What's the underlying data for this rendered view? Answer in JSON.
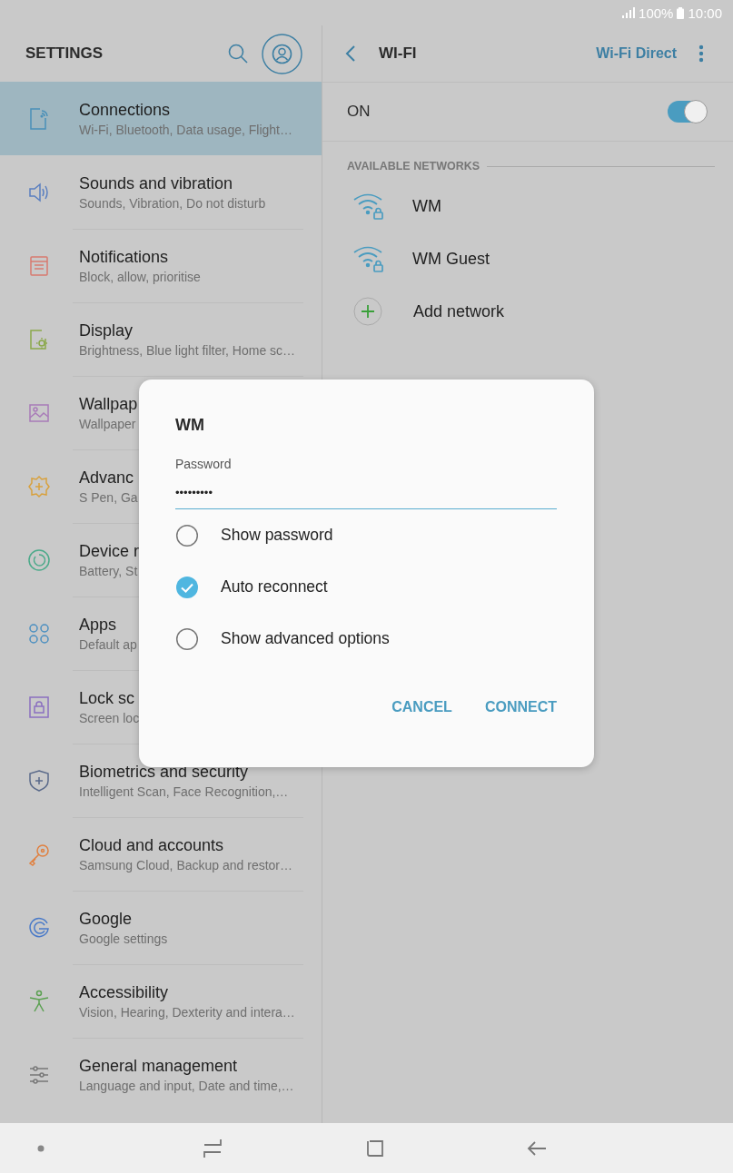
{
  "status_bar": {
    "battery": "100%",
    "time": "10:00"
  },
  "settings": {
    "title": "SETTINGS",
    "items": [
      {
        "title": "Connections",
        "subtitle": "Wi-Fi, Bluetooth, Data usage, Flight…",
        "selected": true
      },
      {
        "title": "Sounds and vibration",
        "subtitle": "Sounds, Vibration, Do not disturb",
        "selected": false
      },
      {
        "title": "Notifications",
        "subtitle": "Block, allow, prioritise",
        "selected": false
      },
      {
        "title": "Display",
        "subtitle": "Brightness, Blue light filter, Home sc…",
        "selected": false
      },
      {
        "title": "Wallpap",
        "subtitle": "Wallpaper",
        "selected": false
      },
      {
        "title": "Advanc",
        "subtitle": "S Pen, Ga",
        "selected": false
      },
      {
        "title": "Device r",
        "subtitle": "Battery, St",
        "selected": false
      },
      {
        "title": "Apps",
        "subtitle": "Default ap",
        "selected": false
      },
      {
        "title": "Lock sc",
        "subtitle": "Screen loc",
        "selected": false
      },
      {
        "title": "Biometrics and security",
        "subtitle": "Intelligent Scan, Face Recognition,…",
        "selected": false
      },
      {
        "title": "Cloud and accounts",
        "subtitle": "Samsung Cloud, Backup and restor…",
        "selected": false
      },
      {
        "title": "Google",
        "subtitle": "Google settings",
        "selected": false
      },
      {
        "title": "Accessibility",
        "subtitle": "Vision, Hearing, Dexterity and intera…",
        "selected": false
      },
      {
        "title": "General management",
        "subtitle": "Language and input, Date and time,…",
        "selected": false
      }
    ]
  },
  "wifi": {
    "title": "WI-FI",
    "action": "Wi-Fi Direct",
    "master": {
      "label": "ON",
      "on": true
    },
    "section": "AVAILABLE NETWORKS",
    "networks": [
      {
        "kind": "secured",
        "name": "WM"
      },
      {
        "kind": "secured",
        "name": "WM Guest"
      },
      {
        "kind": "add",
        "name": "Add network"
      }
    ]
  },
  "dialog": {
    "title": "WM",
    "field_label": "Password",
    "value": "•••••••••",
    "options": [
      {
        "label": "Show password",
        "checked": false
      },
      {
        "label": "Auto reconnect",
        "checked": true
      },
      {
        "label": "Show advanced options",
        "checked": false
      }
    ],
    "buttons": [
      "CANCEL",
      "CONNECT"
    ]
  }
}
